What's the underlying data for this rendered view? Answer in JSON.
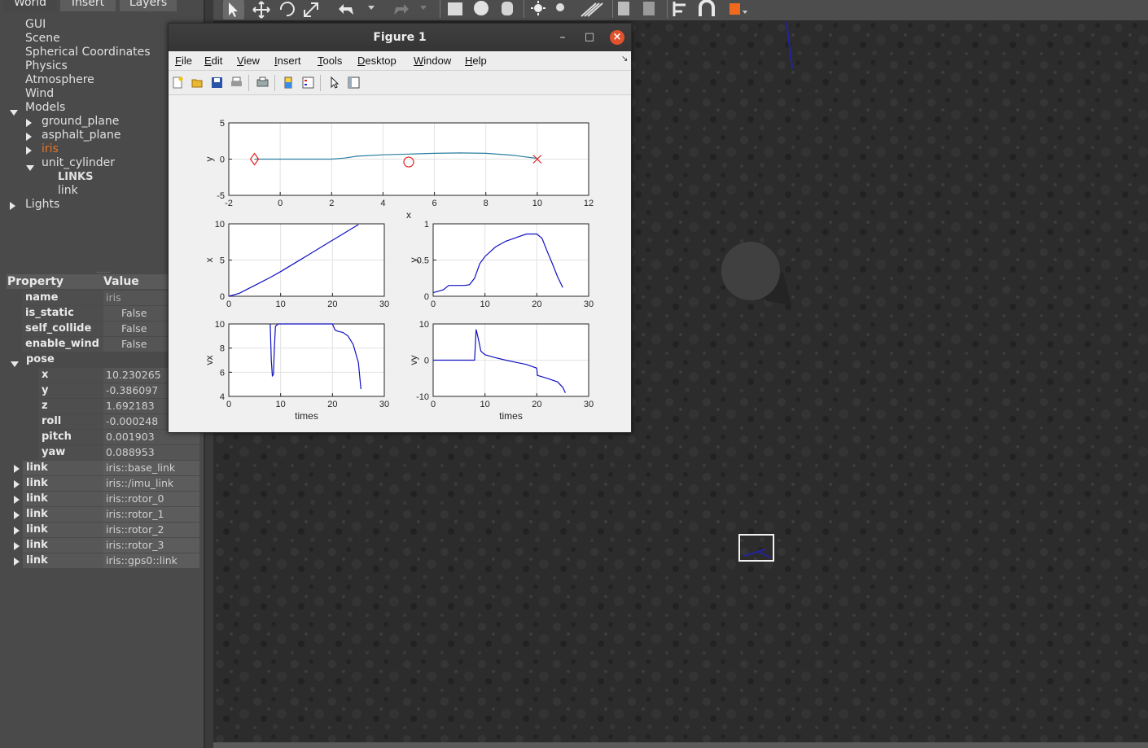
{
  "left_panel": {
    "tabs": [
      "World",
      "Insert",
      "Layers"
    ],
    "tree": [
      {
        "label": "GUI",
        "level": 0,
        "expander": "none"
      },
      {
        "label": "Scene",
        "level": 0,
        "expander": "none"
      },
      {
        "label": "Spherical Coordinates",
        "level": 0,
        "expander": "none"
      },
      {
        "label": "Physics",
        "level": 0,
        "expander": "none"
      },
      {
        "label": "Atmosphere",
        "level": 0,
        "expander": "none"
      },
      {
        "label": "Wind",
        "level": 0,
        "expander": "none"
      },
      {
        "label": "Models",
        "level": 0,
        "expander": "down"
      },
      {
        "label": "ground_plane",
        "level": 1,
        "expander": "right"
      },
      {
        "label": "asphalt_plane",
        "level": 1,
        "expander": "right"
      },
      {
        "label": "iris",
        "level": 1,
        "expander": "right",
        "highlight": "#e8741e"
      },
      {
        "label": "unit_cylinder",
        "level": 1,
        "expander": "down"
      },
      {
        "label": "LINKS",
        "level": 2,
        "expander": "none",
        "bold": true
      },
      {
        "label": "link",
        "level": 2,
        "expander": "none"
      },
      {
        "label": "Lights",
        "level": 0,
        "expander": "right"
      }
    ],
    "splitter": "......",
    "properties": {
      "header": {
        "property": "Property",
        "value": "Value"
      },
      "rows": [
        {
          "name": "name",
          "value": "iris",
          "indent": 1,
          "checkbox": false
        },
        {
          "name": "is_static",
          "value": "False",
          "indent": 1,
          "checkbox": true
        },
        {
          "name": "self_collide",
          "value": "False",
          "indent": 1,
          "checkbox": true
        },
        {
          "name": "enable_wind",
          "value": "False",
          "indent": 1,
          "checkbox": true
        },
        {
          "name": "pose",
          "value": "",
          "indent": 0,
          "expander": "down"
        },
        {
          "name": "x",
          "value": "10.230265",
          "indent": 2
        },
        {
          "name": "y",
          "value": "-0.386097",
          "indent": 2
        },
        {
          "name": "z",
          "value": "1.692183",
          "indent": 2
        },
        {
          "name": "roll",
          "value": "-0.000248",
          "indent": 2
        },
        {
          "name": "pitch",
          "value": "0.001903",
          "indent": 2
        },
        {
          "name": "yaw",
          "value": "0.088953",
          "indent": 2
        },
        {
          "name": "link",
          "value": "iris::base_link",
          "indent": 0,
          "expander": "right"
        },
        {
          "name": "link",
          "value": "iris::/imu_link",
          "indent": 0,
          "expander": "right"
        },
        {
          "name": "link",
          "value": "iris::rotor_0",
          "indent": 0,
          "expander": "right"
        },
        {
          "name": "link",
          "value": "iris::rotor_1",
          "indent": 0,
          "expander": "right"
        },
        {
          "name": "link",
          "value": "iris::rotor_2",
          "indent": 0,
          "expander": "right"
        },
        {
          "name": "link",
          "value": "iris::rotor_3",
          "indent": 0,
          "expander": "right"
        },
        {
          "name": "link",
          "value": "iris::gps0::link",
          "indent": 0,
          "expander": "right"
        }
      ]
    }
  },
  "figure": {
    "title": "Figure 1",
    "window_buttons": {
      "minimize": "–",
      "maximize": "□",
      "close": "×"
    },
    "menus": [
      {
        "label": "File",
        "mnemonic": "F"
      },
      {
        "label": "Edit",
        "mnemonic": "E"
      },
      {
        "label": "View",
        "mnemonic": "V"
      },
      {
        "label": "Insert",
        "mnemonic": "I"
      },
      {
        "label": "Tools",
        "mnemonic": "T"
      },
      {
        "label": "Desktop",
        "mnemonic": "D"
      },
      {
        "label": "Window",
        "mnemonic": "W"
      },
      {
        "label": "Help",
        "mnemonic": "H"
      }
    ],
    "toolbar_icons": [
      "new-figure-icon",
      "open-file-icon",
      "save-icon",
      "print-icon",
      "print-preview-icon",
      "colorbar-icon",
      "legend-icon",
      "pointer-icon",
      "property-inspector-icon"
    ]
  },
  "chart_data": [
    {
      "type": "line",
      "xlabel": "x",
      "ylabel": "y",
      "xlim": [
        -2,
        12
      ],
      "ylim": [
        -5,
        5
      ],
      "xticks": [
        -2,
        0,
        2,
        4,
        6,
        8,
        10,
        12
      ],
      "yticks": [
        -5,
        0,
        5
      ],
      "grid": true,
      "series": [
        {
          "color": "#2a7fa0",
          "x": [
            -1,
            0,
            1,
            2,
            2.5,
            3,
            4,
            5,
            6,
            7,
            8,
            9,
            10
          ],
          "y": [
            0,
            0,
            0,
            0,
            0.15,
            0.4,
            0.6,
            0.7,
            0.8,
            0.85,
            0.8,
            0.55,
            0.1
          ]
        }
      ],
      "markers": [
        {
          "shape": "diamond",
          "color": "#d22",
          "x": -1,
          "y": 0
        },
        {
          "shape": "circle",
          "color": "#d22",
          "x": 5,
          "y": -0.4
        },
        {
          "shape": "x",
          "color": "#d22",
          "x": 10,
          "y": 0
        }
      ]
    },
    {
      "type": "line",
      "xlabel": "",
      "ylabel": "x",
      "xlim": [
        0,
        30
      ],
      "ylim": [
        0,
        10
      ],
      "xticks": [
        0,
        10,
        20,
        30
      ],
      "yticks": [
        0,
        5,
        10
      ],
      "grid": true,
      "series": [
        {
          "color": "#1010c0",
          "x": [
            0,
            2,
            5,
            8,
            10,
            13,
            16,
            19,
            22,
            25
          ],
          "y": [
            0,
            0.4,
            1.5,
            2.6,
            3.4,
            4.7,
            6.0,
            7.3,
            8.6,
            9.9
          ]
        }
      ]
    },
    {
      "type": "line",
      "xlabel": "",
      "ylabel": "y",
      "xlim": [
        0,
        30
      ],
      "ylim": [
        0,
        1
      ],
      "xticks": [
        0,
        10,
        20,
        30
      ],
      "yticks": [
        0,
        0.5,
        1
      ],
      "grid": true,
      "series": [
        {
          "color": "#1010c0",
          "x": [
            0,
            1,
            2,
            3,
            4,
            5,
            6,
            7,
            8,
            9,
            10,
            12,
            14,
            16,
            18,
            20,
            21,
            22,
            23,
            24,
            25
          ],
          "y": [
            0.05,
            0.07,
            0.09,
            0.15,
            0.15,
            0.15,
            0.15,
            0.16,
            0.25,
            0.45,
            0.55,
            0.68,
            0.76,
            0.81,
            0.86,
            0.86,
            0.8,
            0.62,
            0.45,
            0.27,
            0.12
          ]
        }
      ]
    },
    {
      "type": "line",
      "xlabel": "times",
      "ylabel": "vx",
      "xlim": [
        0,
        30
      ],
      "ylim": [
        4,
        10
      ],
      "xticks": [
        0,
        10,
        20,
        30
      ],
      "yticks": [
        4,
        6,
        8,
        10
      ],
      "grid": true,
      "series": [
        {
          "color": "#1010c0",
          "x": [
            8,
            8.2,
            8.4,
            8.6,
            8.8,
            9,
            9.5,
            10,
            11,
            12,
            14,
            16,
            18,
            20,
            20.5,
            21,
            22,
            23,
            24,
            25,
            25.5
          ],
          "y": [
            10,
            7,
            5.7,
            5.8,
            8,
            9.8,
            10,
            10,
            10,
            10,
            10,
            10,
            10,
            10,
            9.5,
            9.4,
            9.3,
            9.0,
            8.3,
            6.8,
            4.6
          ]
        }
      ]
    },
    {
      "type": "line",
      "xlabel": "times",
      "ylabel": "vy",
      "xlim": [
        0,
        30
      ],
      "ylim": [
        -10,
        10
      ],
      "xticks": [
        0,
        10,
        20,
        30
      ],
      "yticks": [
        -10,
        0,
        10
      ],
      "grid": true,
      "series": [
        {
          "color": "#1010c0",
          "x": [
            0,
            2,
            4,
            6,
            8,
            8.3,
            8.7,
            9.2,
            10,
            12,
            14,
            16,
            18,
            20,
            20.1,
            22,
            24,
            25,
            25.5
          ],
          "y": [
            0,
            0,
            0,
            0,
            0,
            8.5,
            6,
            2.5,
            1.5,
            0.7,
            0,
            -0.6,
            -1.2,
            -2.2,
            -4.2,
            -5,
            -6,
            -7.5,
            -9
          ]
        }
      ]
    }
  ],
  "viewport": {
    "ground_color": "#2b2b2b",
    "cylinder_color": "#3a3a3a",
    "selection_color": "#ffffff"
  }
}
